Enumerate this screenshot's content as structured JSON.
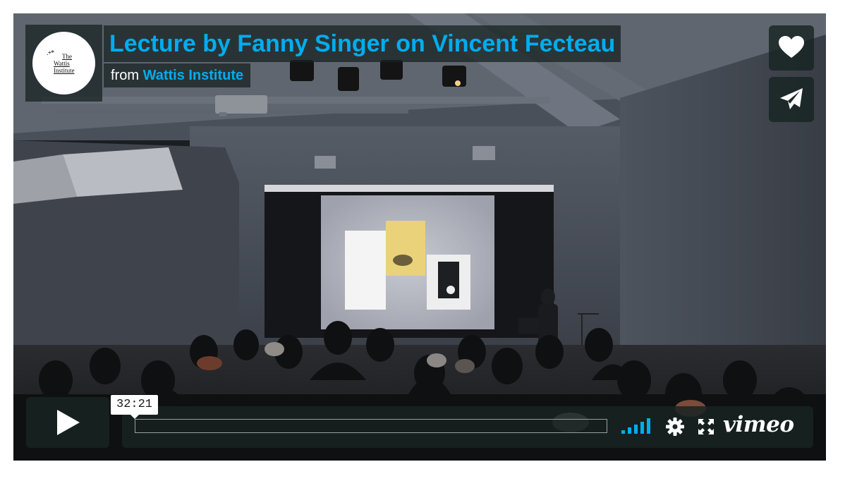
{
  "video": {
    "title": "Lecture by Fanny Singer on Vincent Fecteau",
    "byline_prefix": "from",
    "author": "Wattis Institute",
    "portrait": {
      "mark": ".+*",
      "line1": "The",
      "line2": "Wattis",
      "line3": "Institute"
    }
  },
  "controls": {
    "timecode": "32:21",
    "progress": 0.0,
    "volume_level": 1.0,
    "brand": "vimeo"
  },
  "icons": {
    "like": "heart-icon",
    "share": "paper-plane-icon",
    "play": "play-icon",
    "settings": "gear-icon",
    "fullscreen": "fullscreen-icon",
    "volume": "volume-bars-icon"
  },
  "colors": {
    "accent": "#00adef",
    "overlay": "#172322"
  }
}
